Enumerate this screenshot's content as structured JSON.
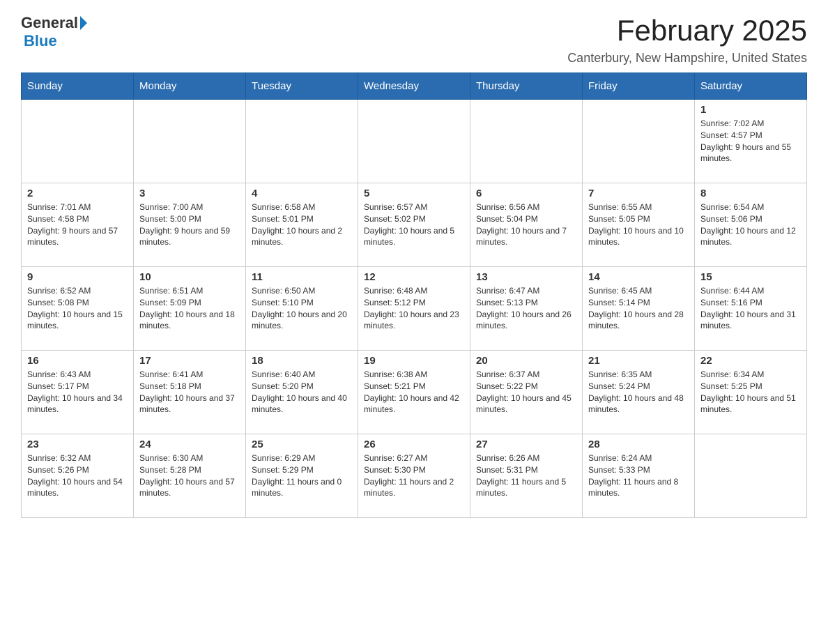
{
  "logo": {
    "general": "General",
    "blue": "Blue"
  },
  "title": {
    "month_year": "February 2025",
    "location": "Canterbury, New Hampshire, United States"
  },
  "weekdays": [
    "Sunday",
    "Monday",
    "Tuesday",
    "Wednesday",
    "Thursday",
    "Friday",
    "Saturday"
  ],
  "weeks": [
    [
      {
        "day": "",
        "info": ""
      },
      {
        "day": "",
        "info": ""
      },
      {
        "day": "",
        "info": ""
      },
      {
        "day": "",
        "info": ""
      },
      {
        "day": "",
        "info": ""
      },
      {
        "day": "",
        "info": ""
      },
      {
        "day": "1",
        "info": "Sunrise: 7:02 AM\nSunset: 4:57 PM\nDaylight: 9 hours and 55 minutes."
      }
    ],
    [
      {
        "day": "2",
        "info": "Sunrise: 7:01 AM\nSunset: 4:58 PM\nDaylight: 9 hours and 57 minutes."
      },
      {
        "day": "3",
        "info": "Sunrise: 7:00 AM\nSunset: 5:00 PM\nDaylight: 9 hours and 59 minutes."
      },
      {
        "day": "4",
        "info": "Sunrise: 6:58 AM\nSunset: 5:01 PM\nDaylight: 10 hours and 2 minutes."
      },
      {
        "day": "5",
        "info": "Sunrise: 6:57 AM\nSunset: 5:02 PM\nDaylight: 10 hours and 5 minutes."
      },
      {
        "day": "6",
        "info": "Sunrise: 6:56 AM\nSunset: 5:04 PM\nDaylight: 10 hours and 7 minutes."
      },
      {
        "day": "7",
        "info": "Sunrise: 6:55 AM\nSunset: 5:05 PM\nDaylight: 10 hours and 10 minutes."
      },
      {
        "day": "8",
        "info": "Sunrise: 6:54 AM\nSunset: 5:06 PM\nDaylight: 10 hours and 12 minutes."
      }
    ],
    [
      {
        "day": "9",
        "info": "Sunrise: 6:52 AM\nSunset: 5:08 PM\nDaylight: 10 hours and 15 minutes."
      },
      {
        "day": "10",
        "info": "Sunrise: 6:51 AM\nSunset: 5:09 PM\nDaylight: 10 hours and 18 minutes."
      },
      {
        "day": "11",
        "info": "Sunrise: 6:50 AM\nSunset: 5:10 PM\nDaylight: 10 hours and 20 minutes."
      },
      {
        "day": "12",
        "info": "Sunrise: 6:48 AM\nSunset: 5:12 PM\nDaylight: 10 hours and 23 minutes."
      },
      {
        "day": "13",
        "info": "Sunrise: 6:47 AM\nSunset: 5:13 PM\nDaylight: 10 hours and 26 minutes."
      },
      {
        "day": "14",
        "info": "Sunrise: 6:45 AM\nSunset: 5:14 PM\nDaylight: 10 hours and 28 minutes."
      },
      {
        "day": "15",
        "info": "Sunrise: 6:44 AM\nSunset: 5:16 PM\nDaylight: 10 hours and 31 minutes."
      }
    ],
    [
      {
        "day": "16",
        "info": "Sunrise: 6:43 AM\nSunset: 5:17 PM\nDaylight: 10 hours and 34 minutes."
      },
      {
        "day": "17",
        "info": "Sunrise: 6:41 AM\nSunset: 5:18 PM\nDaylight: 10 hours and 37 minutes."
      },
      {
        "day": "18",
        "info": "Sunrise: 6:40 AM\nSunset: 5:20 PM\nDaylight: 10 hours and 40 minutes."
      },
      {
        "day": "19",
        "info": "Sunrise: 6:38 AM\nSunset: 5:21 PM\nDaylight: 10 hours and 42 minutes."
      },
      {
        "day": "20",
        "info": "Sunrise: 6:37 AM\nSunset: 5:22 PM\nDaylight: 10 hours and 45 minutes."
      },
      {
        "day": "21",
        "info": "Sunrise: 6:35 AM\nSunset: 5:24 PM\nDaylight: 10 hours and 48 minutes."
      },
      {
        "day": "22",
        "info": "Sunrise: 6:34 AM\nSunset: 5:25 PM\nDaylight: 10 hours and 51 minutes."
      }
    ],
    [
      {
        "day": "23",
        "info": "Sunrise: 6:32 AM\nSunset: 5:26 PM\nDaylight: 10 hours and 54 minutes."
      },
      {
        "day": "24",
        "info": "Sunrise: 6:30 AM\nSunset: 5:28 PM\nDaylight: 10 hours and 57 minutes."
      },
      {
        "day": "25",
        "info": "Sunrise: 6:29 AM\nSunset: 5:29 PM\nDaylight: 11 hours and 0 minutes."
      },
      {
        "day": "26",
        "info": "Sunrise: 6:27 AM\nSunset: 5:30 PM\nDaylight: 11 hours and 2 minutes."
      },
      {
        "day": "27",
        "info": "Sunrise: 6:26 AM\nSunset: 5:31 PM\nDaylight: 11 hours and 5 minutes."
      },
      {
        "day": "28",
        "info": "Sunrise: 6:24 AM\nSunset: 5:33 PM\nDaylight: 11 hours and 8 minutes."
      },
      {
        "day": "",
        "info": ""
      }
    ]
  ]
}
